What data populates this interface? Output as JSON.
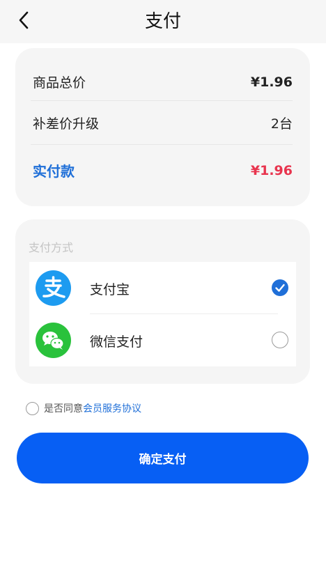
{
  "header": {
    "title": "支付",
    "back_icon": "chevron-left-icon"
  },
  "summary": {
    "total_label": "商品总价",
    "total_value": "¥1.96",
    "upgrade_label": "补差价升级",
    "upgrade_value": "2台",
    "paid_label": "实付款",
    "paid_value": "¥1.96"
  },
  "payment": {
    "section_title": "支付方式",
    "methods": [
      {
        "name": "支付宝",
        "icon": "alipay-icon",
        "selected": true,
        "color": "#1d9bf0"
      },
      {
        "name": "微信支付",
        "icon": "wechat-icon",
        "selected": false,
        "color": "#2ac23c"
      }
    ]
  },
  "agreement": {
    "prefix": "是否同意",
    "link": "会员服务协议",
    "checked": false
  },
  "confirm_button": {
    "label": "确定支付",
    "color": "#075ff4"
  },
  "colors": {
    "accent_blue": "#1f6fd8",
    "price_red": "#e8344e"
  }
}
